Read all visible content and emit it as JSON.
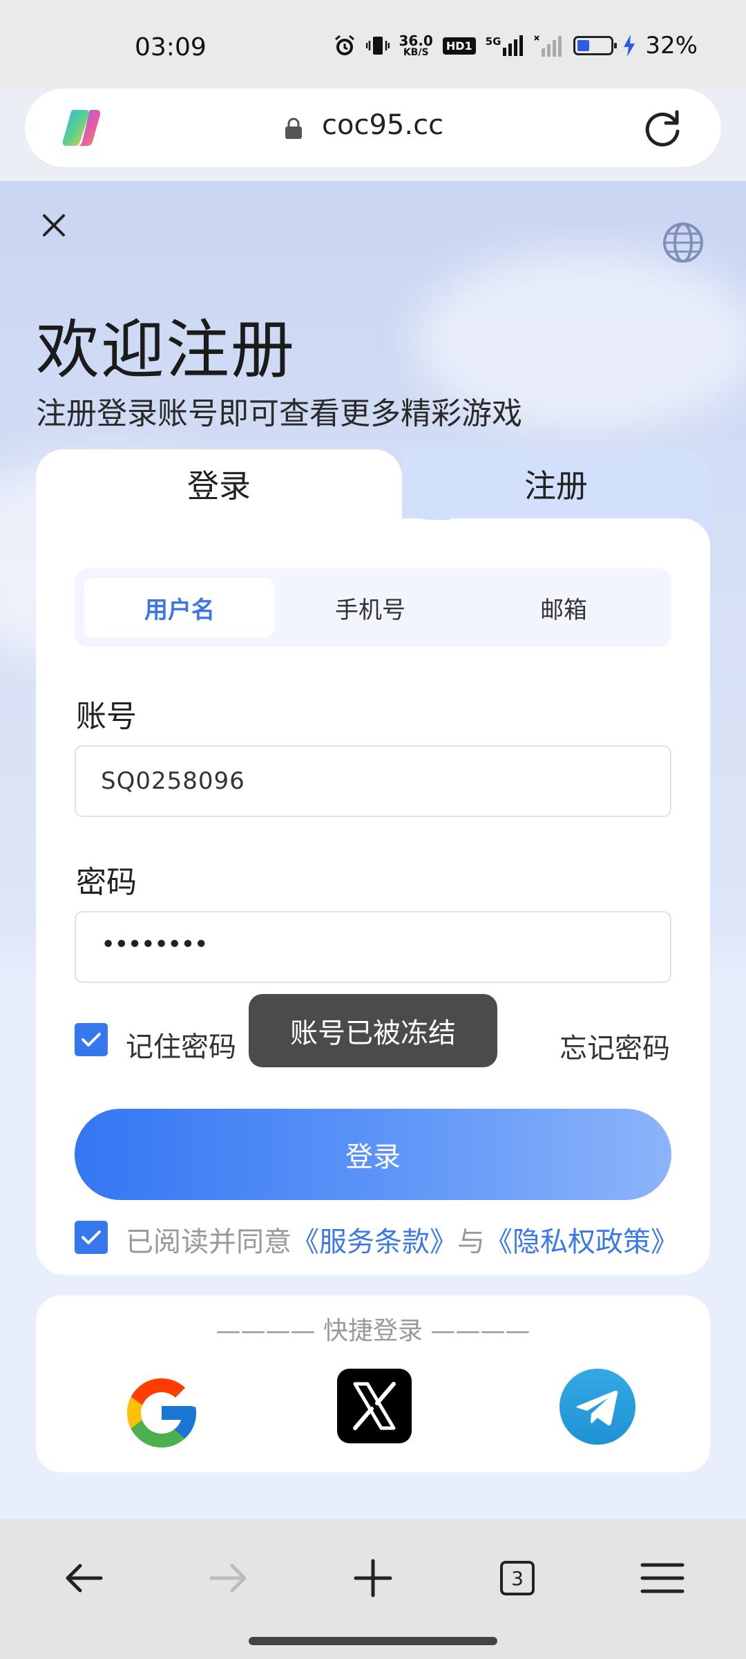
{
  "status_bar": {
    "time": "03:09",
    "network_speed": "36.0",
    "network_speed_unit": "KB/S",
    "hd_label": "HD1",
    "network_type": "5G",
    "battery_level": 0.32,
    "battery_percent": "32%"
  },
  "url_bar": {
    "url": "coc95.cc"
  },
  "page": {
    "title": "欢迎注册",
    "subtitle": "注册登录账号即可查看更多精彩游戏"
  },
  "tabs": {
    "login": "登录",
    "register": "注册"
  },
  "login_methods": {
    "items": [
      "用户名",
      "手机号",
      "邮箱"
    ],
    "selected": "用户名"
  },
  "form": {
    "account_label": "账号",
    "account_value": "SQ0258096",
    "password_label": "密码",
    "password_masked": "••••••••",
    "remember_label": "记住密码",
    "remember_checked": true,
    "forgot_label": "忘记密码",
    "login_button": "登录",
    "agree_checked": true,
    "agree_prefix": "已阅读并同意",
    "terms_link": "《服务条款》",
    "agree_and": "与",
    "privacy_link": "《隐私权政策》"
  },
  "toast": {
    "message": "账号已被冻结"
  },
  "quick_login": {
    "title": "———— 快捷登录 ————",
    "providers": [
      "google-icon",
      "x-icon",
      "telegram-icon"
    ]
  },
  "bottom_nav": {
    "tab_count": "3"
  },
  "colors": {
    "accent": "#3b76e6",
    "button_gradient_start": "#3476f3",
    "button_gradient_end": "#8cb4fa",
    "toast_bg": "#4b4b4b"
  }
}
